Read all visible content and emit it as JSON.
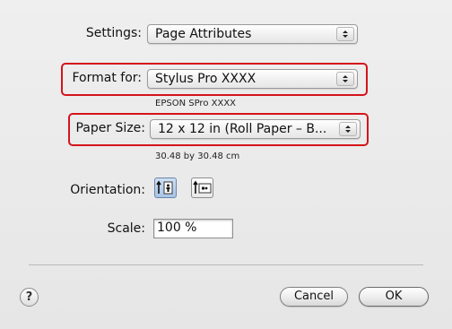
{
  "settings": {
    "label": "Settings:",
    "value": "Page Attributes"
  },
  "format_for": {
    "label": "Format for:",
    "value": "Stylus Pro XXXX",
    "subtext": "EPSON SPro XXXX"
  },
  "paper_size": {
    "label": "Paper Size:",
    "value": "12 x 12 in (Roll Paper – B...",
    "subtext": "30.48 by 30.48 cm"
  },
  "orientation": {
    "label": "Orientation:",
    "options": [
      "portrait",
      "landscape"
    ],
    "selected": "portrait"
  },
  "scale": {
    "label": "Scale:",
    "value": "100 %"
  },
  "footer": {
    "help": "?",
    "cancel": "Cancel",
    "ok": "OK"
  },
  "colors": {
    "highlight": "#d4141a",
    "selected_orientation": "#a9c4e6"
  }
}
